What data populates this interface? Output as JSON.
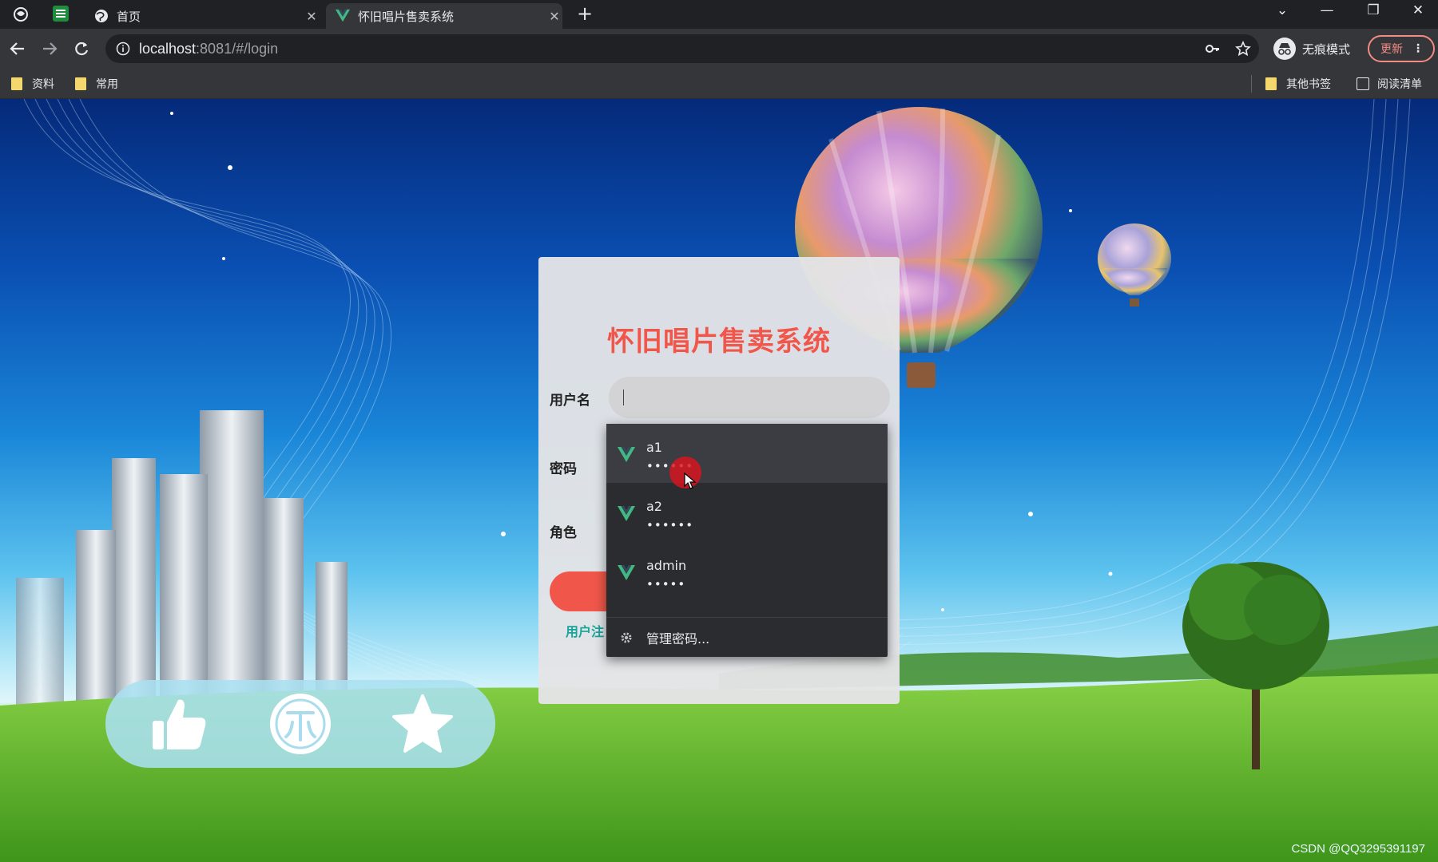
{
  "browser": {
    "tabs": [
      {
        "title": "首页",
        "active": false,
        "favicon": "globe-icon"
      },
      {
        "title": "怀旧唱片售卖系统",
        "active": true,
        "favicon": "vue-logo-icon"
      }
    ],
    "url_host": "localhost",
    "url_path": ":8081/#/login",
    "incognito_label": "无痕模式",
    "update_label": "更新",
    "bookmarks": [
      "资料",
      "常用"
    ],
    "other_bookmarks": "其他书签",
    "reading_list": "阅读清单"
  },
  "login": {
    "title": "怀旧唱片售卖系统",
    "username_label": "用户名",
    "password_label": "密码",
    "role_label": "角色",
    "register_link": "用户注"
  },
  "autofill": {
    "items": [
      {
        "username": "a1",
        "password": "••••••"
      },
      {
        "username": "a2",
        "password": "••••••"
      },
      {
        "username": "admin",
        "password": "•••••"
      }
    ],
    "manage_label": "管理密码..."
  },
  "watermark": "CSDN @QQ3295391197",
  "colors": {
    "accent": "#f0574a",
    "link": "#16a59a",
    "vue_green": "#42b883"
  }
}
